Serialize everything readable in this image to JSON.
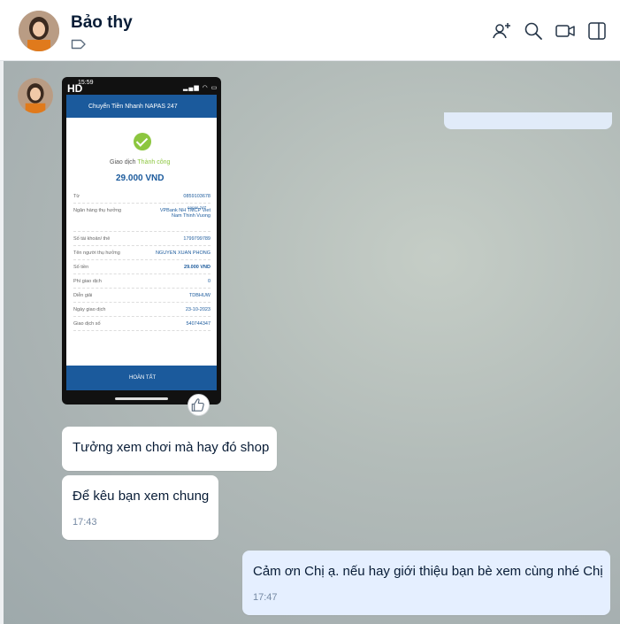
{
  "header": {
    "title": "Bảo thy",
    "icons": [
      "add-member-icon",
      "search-icon",
      "video-call-icon",
      "sidebar-toggle-icon"
    ]
  },
  "image_message": {
    "badge": "HD",
    "phone_time": "15:59",
    "screen_title": "Chuyển Tiền Nhanh NAPAS 247",
    "status_label": "Giao dịch",
    "status_value": "Thành công",
    "amount": "29.000 VND",
    "rows": [
      {
        "label": "Từ",
        "value": "0859103678"
      },
      {
        "label": "Ngân hàng thụ hưởng",
        "value": "VPBank NH TMCP Viet Nam Thinh Vuong"
      },
      {
        "label": "Số tài khoản/ thẻ",
        "value": "1799799789"
      },
      {
        "label": "Tên người thụ hưởng",
        "value": "NGUYEN XUAN PHONG"
      },
      {
        "label": "Số tiền",
        "value": "29.000 VND"
      },
      {
        "label": "Phí giao dịch",
        "value": "0"
      },
      {
        "label": "Diễn giải",
        "value": "TDBHUW"
      },
      {
        "label": "Ngày giao dịch",
        "value": "23-10-2023"
      },
      {
        "label": "Giao dịch số",
        "value": "540744347"
      }
    ],
    "done_label": "HOÀN TẤT",
    "napas_tag": "napas 247"
  },
  "messages": [
    {
      "text": "Tưởng xem chơi mà hay đó shop",
      "time": ""
    },
    {
      "text": "Để kêu bạn xem chung",
      "time": "17:43"
    },
    {
      "text": "Cảm ơn Chị ạ. nếu hay giới thiệu bạn bè xem cùng nhé Chị",
      "time": "17:47"
    }
  ]
}
